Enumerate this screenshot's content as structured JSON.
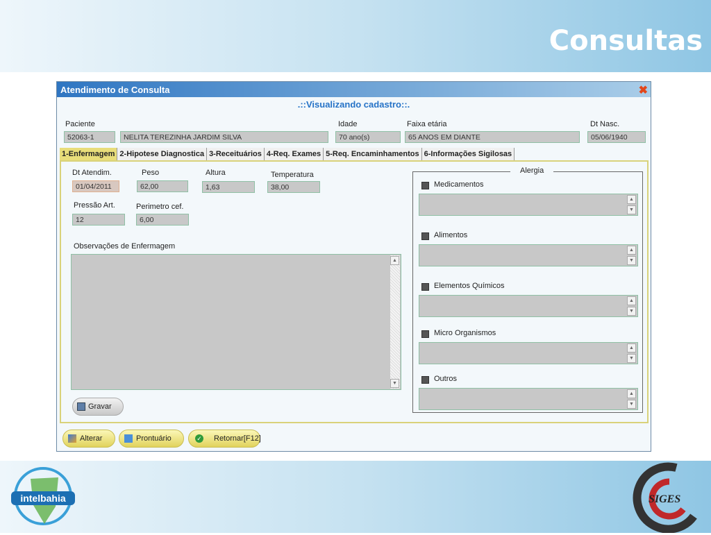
{
  "slide_title": "Consultas",
  "window": {
    "title": "Atendimento de Consulta",
    "subtitle": ".::Visualizando cadastro::."
  },
  "patient": {
    "paciente_label": "Paciente",
    "codigo": "52063-1",
    "nome": "NELITA TEREZINHA JARDIM SILVA",
    "idade_label": "Idade",
    "idade": "70 ano(s)",
    "faixa_label": "Faixa etária",
    "faixa": "65 ANOS EM DIANTE",
    "nasc_label": "Dt Nasc.",
    "nasc": "05/06/1940"
  },
  "tabs": [
    "1-Enfermagem",
    "2-Hipotese Diagnostica",
    "3-Receituários",
    "4-Req. Exames",
    "5-Req. Encaminhamentos",
    "6-Informações Sigilosas"
  ],
  "enfermagem": {
    "dt_label": "Dt Atendim.",
    "dt": "01/04/2011",
    "peso_label": "Peso",
    "peso": "62,00",
    "altura_label": "Altura",
    "altura": "1,63",
    "temp_label": "Temperatura",
    "temp": "38,00",
    "pressao_label": "Pressão Art.",
    "pressao": "12",
    "perim_label": "Perimetro cef.",
    "perim": "6,00",
    "obs_label": "Observações de Enfermagem",
    "gravar": "Gravar"
  },
  "alergia": {
    "title": "Alergia",
    "items": [
      "Medicamentos",
      "Alimentos",
      "Elementos Químicos",
      "Micro Organismos",
      "Outros"
    ]
  },
  "buttons": {
    "alterar": "Alterar",
    "prontuario": "Prontuário",
    "retornar": "Retornar[F12]"
  },
  "logos": {
    "left": "intelbahia",
    "right": "SIGES"
  }
}
